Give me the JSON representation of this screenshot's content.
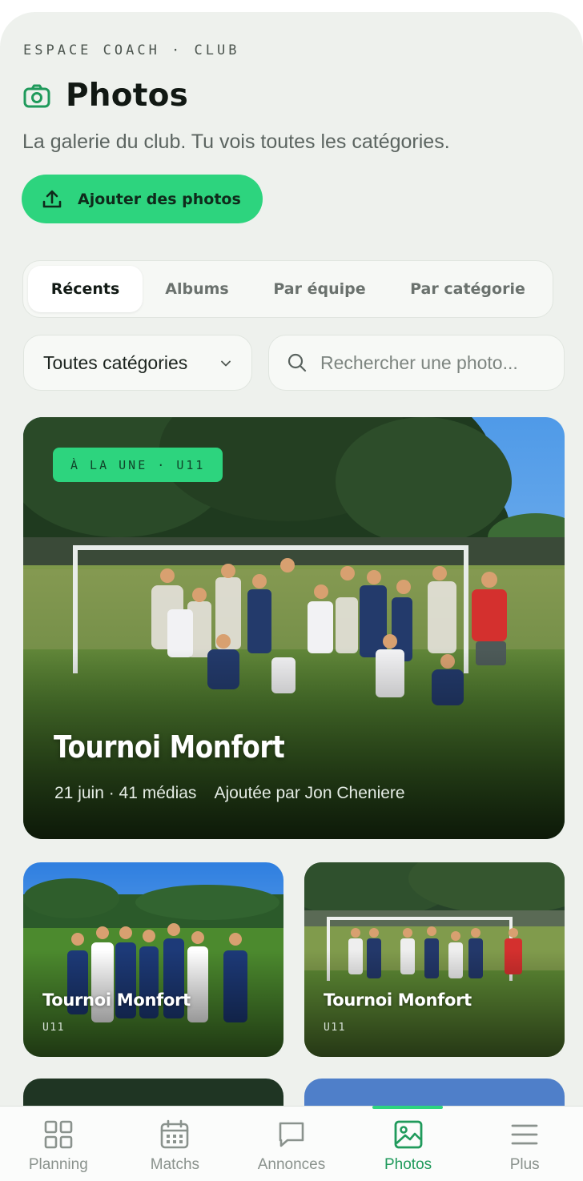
{
  "header": {
    "eyebrow": "ESPACE COACH · CLUB",
    "title": "Photos",
    "subtitle": "La galerie du club. Tu vois toutes les catégories."
  },
  "actions": {
    "add_photos_label": "Ajouter des photos"
  },
  "tabs": [
    {
      "label": "Récents",
      "active": true
    },
    {
      "label": "Albums",
      "active": false
    },
    {
      "label": "Par équipe",
      "active": false
    },
    {
      "label": "Par catégorie",
      "active": false
    }
  ],
  "filters": {
    "category_select": "Toutes catégories",
    "search_placeholder": "Rechercher une photo..."
  },
  "featured": {
    "badge": "À LA UNE · U11",
    "title": "Tournoi Monfort",
    "date_count": "21 juin · 41 médias",
    "added_by": "Ajoutée par Jon Cheniere"
  },
  "grid": [
    {
      "title": "Tournoi Monfort",
      "category": "U11"
    },
    {
      "title": "Tournoi Monfort",
      "category": "U11"
    }
  ],
  "nav": [
    {
      "label": "Planning",
      "icon": "grid-icon",
      "active": false
    },
    {
      "label": "Matchs",
      "icon": "calendar-icon",
      "active": false
    },
    {
      "label": "Annonces",
      "icon": "chat-icon",
      "active": false
    },
    {
      "label": "Photos",
      "icon": "image-icon",
      "active": true
    },
    {
      "label": "Plus",
      "icon": "menu-icon",
      "active": false
    }
  ],
  "colors": {
    "accent": "#2dd47e",
    "accent_text": "#1f9a5b",
    "background": "#eef1ed"
  }
}
